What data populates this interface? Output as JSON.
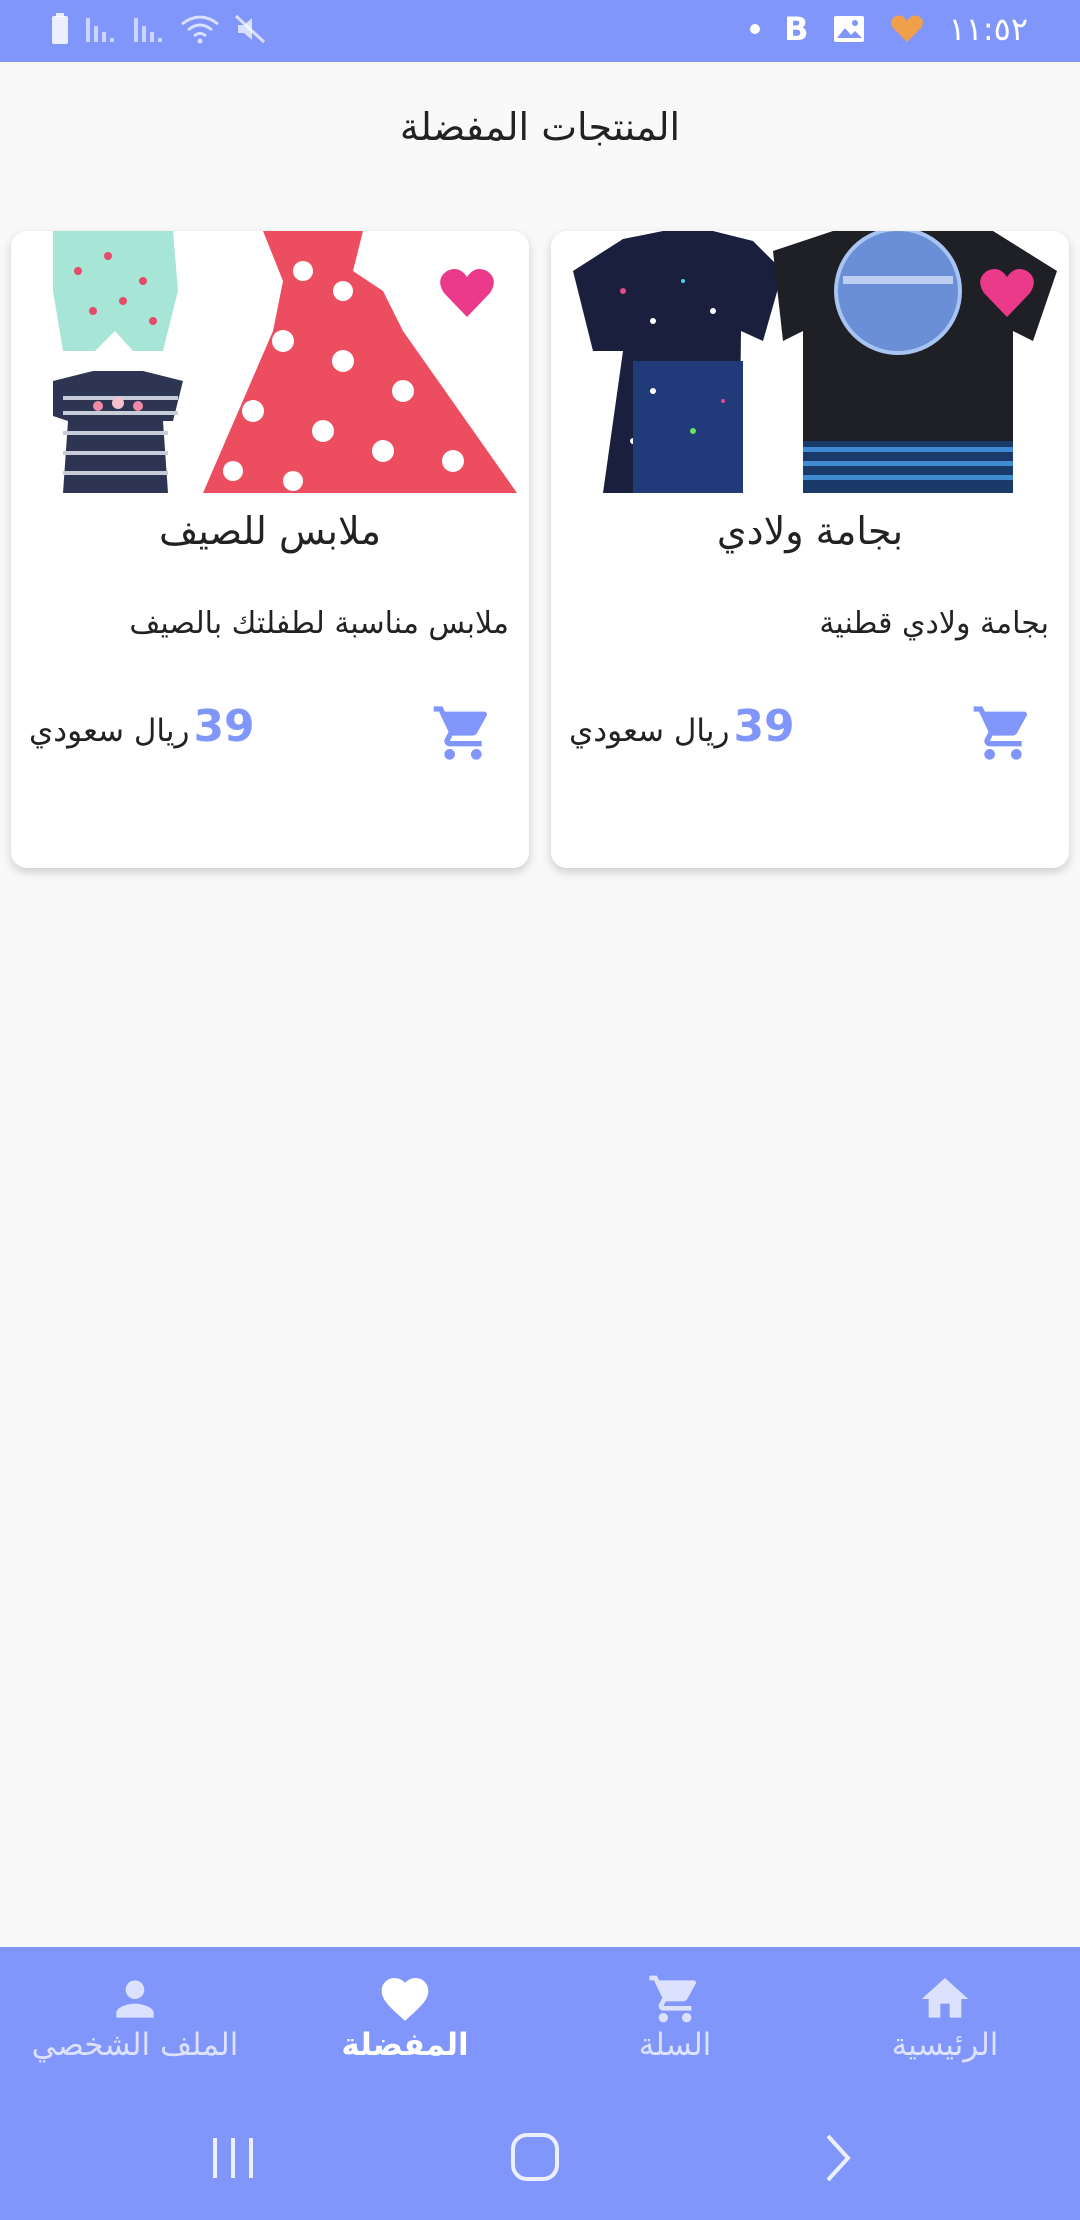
{
  "status_bar": {
    "time": "١١:٥٢",
    "b_label": "B",
    "icons": [
      "battery-icon",
      "signal-icon",
      "signal-icon",
      "wifi-icon",
      "mute-icon",
      "dot-icon",
      "b-icon",
      "image-icon",
      "heart-icon"
    ]
  },
  "page": {
    "title": "المنتجات المفضلة"
  },
  "products": [
    {
      "name": "بجامة ولادي",
      "description": "بجامة ولادي قطنية",
      "price": "39",
      "currency": "ريال سعودي",
      "favorite": true
    },
    {
      "name": "ملابس للصيف",
      "description": "ملابس مناسبة لطفلتك بالصيف",
      "price": "39",
      "currency": "ريال سعودي",
      "favorite": true
    }
  ],
  "bottom_nav": {
    "items": [
      {
        "label": "الرئيسية",
        "icon": "home-icon",
        "active": false
      },
      {
        "label": "السلة",
        "icon": "cart-icon",
        "active": false
      },
      {
        "label": "المفضلة",
        "icon": "heart-icon",
        "active": true
      },
      {
        "label": "الملف الشخصي",
        "icon": "person-icon",
        "active": false
      }
    ]
  },
  "colors": {
    "accent": "#8196fa",
    "heart": "#ec3a8a",
    "text": "#222222"
  }
}
